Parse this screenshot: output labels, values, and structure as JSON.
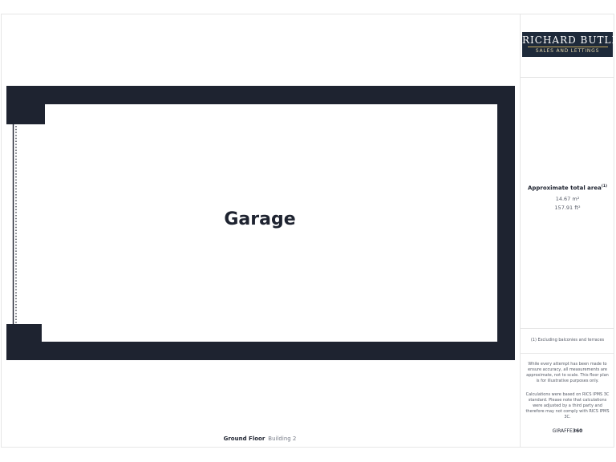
{
  "logo": {
    "name": "RICHARD BUTLER",
    "tagline": "SALES AND LETTINGS"
  },
  "area": {
    "title": "Approximate total area",
    "footnote_mark": "(1)",
    "sqm": "14.67 m²",
    "sqft": "157.91 ft²"
  },
  "notes": {
    "excluding": "(1) Excluding balconies and terraces",
    "disclaimer": "While every attempt has been made to ensure accuracy, all measurements are approximate, not to scale. This floor plan is for illustrative purposes only.",
    "calculation": "Calculations were based on RICS IPMS 3C standard. Please note that calculations were adjusted by a third party and therefore may not comply with RICS IPMS 3C."
  },
  "brand": {
    "prefix": "GIRAFFE",
    "suffix": "360"
  },
  "plan": {
    "room": "Garage",
    "floor": "Ground Floor",
    "building": "Building 2",
    "wall_color": "#1e2330"
  }
}
